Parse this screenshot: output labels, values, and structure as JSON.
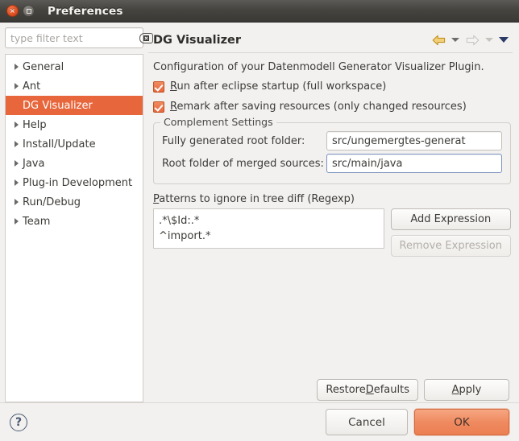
{
  "window": {
    "title": "Preferences",
    "close_label": "×",
    "maximize_label": ""
  },
  "sidebar": {
    "filter": {
      "value": "",
      "placeholder": "type filter text",
      "clear_icon": "clear-icon"
    },
    "items": [
      {
        "label": "General",
        "expandable": true,
        "selected": false
      },
      {
        "label": "Ant",
        "expandable": true,
        "selected": false
      },
      {
        "label": "DG Visualizer",
        "expandable": false,
        "selected": true
      },
      {
        "label": "Help",
        "expandable": true,
        "selected": false
      },
      {
        "label": "Install/Update",
        "expandable": true,
        "selected": false
      },
      {
        "label": "Java",
        "expandable": true,
        "selected": false
      },
      {
        "label": "Plug-in Development",
        "expandable": true,
        "selected": false
      },
      {
        "label": "Run/Debug",
        "expandable": true,
        "selected": false
      },
      {
        "label": "Team",
        "expandable": true,
        "selected": false
      }
    ]
  },
  "page": {
    "title": "DG Visualizer",
    "description": "Configuration of your Datenmodell Generator Visualizer Plugin.",
    "nav": {
      "back_icon": "back-arrow-icon",
      "back_menu_icon": "chevron-down-icon",
      "forward_icon": "forward-arrow-icon",
      "forward_menu_icon": "chevron-down-icon",
      "view_menu_icon": "chevron-down-icon"
    },
    "checkboxes": [
      {
        "mnemonic": "R",
        "rest": "un after eclipse startup (full workspace)",
        "checked": true
      },
      {
        "mnemonic": "R",
        "rest": "emark after saving resources (only changed resources)",
        "checked": true
      }
    ],
    "group": {
      "title": "Complement Settings",
      "fields": [
        {
          "label": "Fully generated root folder:",
          "value": "src/ungemergtes-generat",
          "focused": false
        },
        {
          "label": "Root folder of merged sources:",
          "value": "src/main/java",
          "focused": true
        }
      ]
    },
    "patterns": {
      "label_mnemonic": "P",
      "label_rest": "atterns to ignore in tree diff (Regexp)",
      "items": [
        ".*\\$Id:.*",
        "^import.*"
      ],
      "add_button": "Add Expression",
      "remove_button": "Remove Expression",
      "remove_disabled": true
    },
    "apply_row": {
      "restore_defaults_pre": "Restore ",
      "restore_defaults_mnemonic": "D",
      "restore_defaults_post": "efaults",
      "apply_mnemonic": "A",
      "apply_post": "pply"
    }
  },
  "footer": {
    "help_icon": "help-icon",
    "help_label": "?",
    "cancel_label": "Cancel",
    "ok_label": "OK"
  },
  "colors": {
    "selection_orange": "#e8663c",
    "ok_button_orange": "#ef8a60",
    "titlebar_dark": "#46443f",
    "back_arrow_gold": "#d9a520",
    "view_menu_navy": "#2b3a66",
    "window_bg": "#f2f1f0"
  }
}
